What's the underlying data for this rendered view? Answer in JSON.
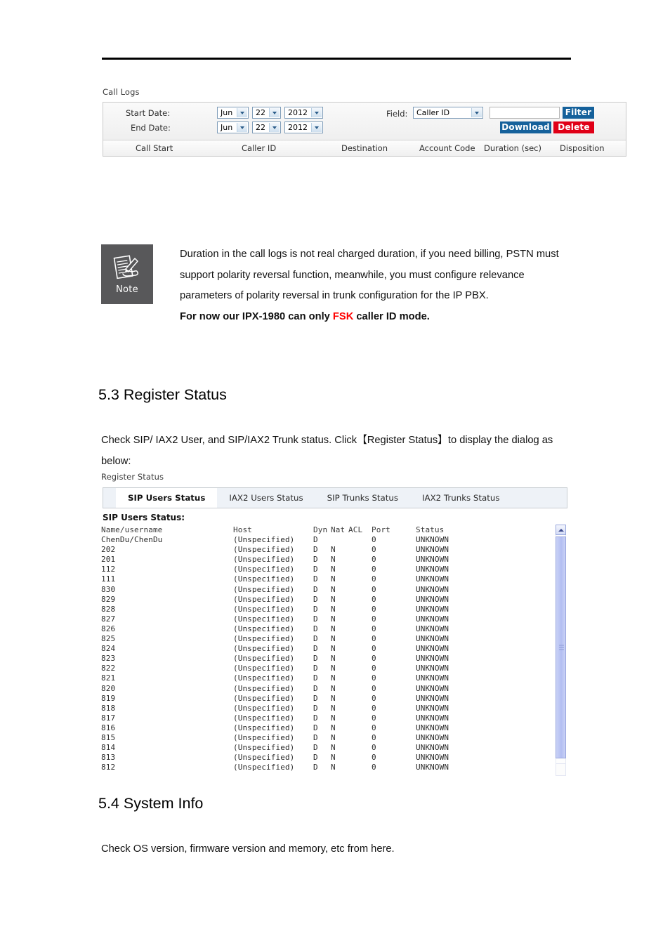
{
  "call_logs": {
    "caption": "Call Logs",
    "labels": {
      "start_date": "Start Date:",
      "end_date": "End Date:",
      "field": "Field:"
    },
    "start_date": {
      "month": "Jun",
      "day": "22",
      "year": "2012"
    },
    "end_date": {
      "month": "Jun",
      "day": "22",
      "year": "2012"
    },
    "field_select": "Caller ID",
    "filter_input_value": "",
    "filter_input_placeholder": "",
    "buttons": {
      "filter": "Filter",
      "download": "Download",
      "delete": "Delete"
    },
    "colors": {
      "button_blue": "#15619b",
      "button_red": "#e00017"
    },
    "columns": [
      "Call Start",
      "Caller ID",
      "Destination",
      "Account Code",
      "Duration (sec)",
      "Disposition"
    ],
    "rows": []
  },
  "note": {
    "label": "Note",
    "icon": "note-pencil-writing-icon",
    "paragraph": "Duration in the call logs is not real charged duration, if you need billing, PSTN must support polarity reversal function, meanwhile, you must configure relevance parameters of polarity reversal in trunk configuration for the IP PBX.",
    "emphasis_prefix": "For now our IPX-1980 can only ",
    "emphasis_highlight": "FSK",
    "emphasis_suffix": " caller ID mode.",
    "highlight_color": "#ff0000"
  },
  "section_register": {
    "heading": "5.3 Register Status",
    "paragraph": "Check SIP/ IAX2 User, and SIP/IAX2 Trunk status. Click【Register Status】to display the dialog as below:",
    "caption": "Register Status",
    "tabs": [
      {
        "label": "SIP Users Status",
        "active": true
      },
      {
        "label": "IAX2 Users Status",
        "active": false
      },
      {
        "label": "SIP Trunks Status",
        "active": false
      },
      {
        "label": "IAX2 Trunks Status",
        "active": false
      }
    ],
    "list_title": "SIP Users Status:",
    "table_headers": {
      "name": "Name/username",
      "host": "Host",
      "dyn": "Dyn",
      "nat": "Nat",
      "acl": "ACL",
      "port": "Port",
      "status": "Status"
    },
    "table_rows": [
      {
        "name": "ChenDu/ChenDu",
        "host": "(Unspecified)",
        "dyn": "D",
        "nat": "",
        "acl": "",
        "port": "0",
        "status": "UNKNOWN"
      },
      {
        "name": "202",
        "host": "(Unspecified)",
        "dyn": "D",
        "nat": "N",
        "acl": "",
        "port": "0",
        "status": "UNKNOWN"
      },
      {
        "name": "201",
        "host": "(Unspecified)",
        "dyn": "D",
        "nat": "N",
        "acl": "",
        "port": "0",
        "status": "UNKNOWN"
      },
      {
        "name": "112",
        "host": "(Unspecified)",
        "dyn": "D",
        "nat": "N",
        "acl": "",
        "port": "0",
        "status": "UNKNOWN"
      },
      {
        "name": "111",
        "host": "(Unspecified)",
        "dyn": "D",
        "nat": "N",
        "acl": "",
        "port": "0",
        "status": "UNKNOWN"
      },
      {
        "name": "830",
        "host": "(Unspecified)",
        "dyn": "D",
        "nat": "N",
        "acl": "",
        "port": "0",
        "status": "UNKNOWN"
      },
      {
        "name": "829",
        "host": "(Unspecified)",
        "dyn": "D",
        "nat": "N",
        "acl": "",
        "port": "0",
        "status": "UNKNOWN"
      },
      {
        "name": "828",
        "host": "(Unspecified)",
        "dyn": "D",
        "nat": "N",
        "acl": "",
        "port": "0",
        "status": "UNKNOWN"
      },
      {
        "name": "827",
        "host": "(Unspecified)",
        "dyn": "D",
        "nat": "N",
        "acl": "",
        "port": "0",
        "status": "UNKNOWN"
      },
      {
        "name": "826",
        "host": "(Unspecified)",
        "dyn": "D",
        "nat": "N",
        "acl": "",
        "port": "0",
        "status": "UNKNOWN"
      },
      {
        "name": "825",
        "host": "(Unspecified)",
        "dyn": "D",
        "nat": "N",
        "acl": "",
        "port": "0",
        "status": "UNKNOWN"
      },
      {
        "name": "824",
        "host": "(Unspecified)",
        "dyn": "D",
        "nat": "N",
        "acl": "",
        "port": "0",
        "status": "UNKNOWN"
      },
      {
        "name": "823",
        "host": "(Unspecified)",
        "dyn": "D",
        "nat": "N",
        "acl": "",
        "port": "0",
        "status": "UNKNOWN"
      },
      {
        "name": "822",
        "host": "(Unspecified)",
        "dyn": "D",
        "nat": "N",
        "acl": "",
        "port": "0",
        "status": "UNKNOWN"
      },
      {
        "name": "821",
        "host": "(Unspecified)",
        "dyn": "D",
        "nat": "N",
        "acl": "",
        "port": "0",
        "status": "UNKNOWN"
      },
      {
        "name": "820",
        "host": "(Unspecified)",
        "dyn": "D",
        "nat": "N",
        "acl": "",
        "port": "0",
        "status": "UNKNOWN"
      },
      {
        "name": "819",
        "host": "(Unspecified)",
        "dyn": "D",
        "nat": "N",
        "acl": "",
        "port": "0",
        "status": "UNKNOWN"
      },
      {
        "name": "818",
        "host": "(Unspecified)",
        "dyn": "D",
        "nat": "N",
        "acl": "",
        "port": "0",
        "status": "UNKNOWN"
      },
      {
        "name": "817",
        "host": "(Unspecified)",
        "dyn": "D",
        "nat": "N",
        "acl": "",
        "port": "0",
        "status": "UNKNOWN"
      },
      {
        "name": "816",
        "host": "(Unspecified)",
        "dyn": "D",
        "nat": "N",
        "acl": "",
        "port": "0",
        "status": "UNKNOWN"
      },
      {
        "name": "815",
        "host": "(Unspecified)",
        "dyn": "D",
        "nat": "N",
        "acl": "",
        "port": "0",
        "status": "UNKNOWN"
      },
      {
        "name": "814",
        "host": "(Unspecified)",
        "dyn": "D",
        "nat": "N",
        "acl": "",
        "port": "0",
        "status": "UNKNOWN"
      },
      {
        "name": "813",
        "host": "(Unspecified)",
        "dyn": "D",
        "nat": "N",
        "acl": "",
        "port": "0",
        "status": "UNKNOWN"
      },
      {
        "name": "812",
        "host": "(Unspecified)",
        "dyn": "D",
        "nat": "N",
        "acl": "",
        "port": "0",
        "status": "UNKNOWN"
      }
    ]
  },
  "section_system": {
    "heading": "5.4 System Info",
    "paragraph": "Check OS version, firmware version and memory, etc from here."
  }
}
